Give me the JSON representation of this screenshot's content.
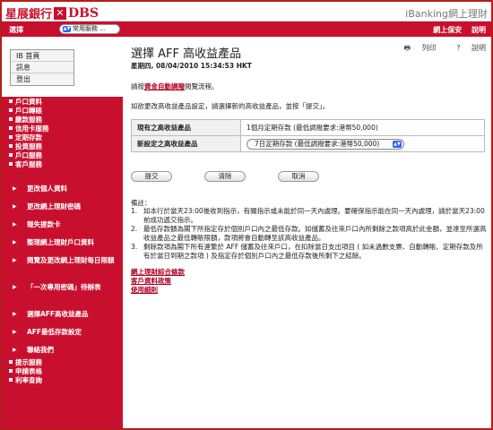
{
  "header": {
    "logo_cn": "星展銀行",
    "logo_dbs": "DBS",
    "title": "iBanking網上理財"
  },
  "navbar": {
    "select_label": "選擇",
    "select_value": "常用服務 ...",
    "right_links": [
      "網上保安",
      "說明"
    ]
  },
  "sidebar": {
    "top_links": [
      "IB 首頁",
      "訊息",
      "登出"
    ],
    "sections_top": [
      "戶口資料",
      "戶口轉賬",
      "繳款服務",
      "信用卡服務",
      "定期存款",
      "投資服務",
      "戶口服務",
      "客戶服務"
    ],
    "sub_items": [
      "更改個人資料",
      "更改網上理財密碼",
      "報失提款卡",
      "整理網上理財戶口資料",
      "閱覽及更改網上理財每日限額",
      "「一次專用密碼」待辦表",
      "選擇AFF高收益產品",
      "AFF最低存款設定",
      "聯絡我們"
    ],
    "sections_bottom": [
      "提示服務",
      "申請表格",
      "利率查詢"
    ]
  },
  "main": {
    "print_label": "列印",
    "help_label": "說明",
    "title": "選擇 AFF 高收益產品",
    "timestamp": "星期四, 08/04/2010 15:34:53 HKT",
    "line1_prefix": "請按",
    "line1_link": "資金自動調撥",
    "line1_suffix": "閱覽流程。",
    "line2": "如欲更改高收益產品設定，請選擇新的高收益產品，並按「提交」。",
    "current_label": "現有之高收益產品",
    "current_value": "1個月定期存款 (最低調撥要求:港幣50,000)",
    "new_label": "新設定之高收益產品",
    "new_value": "7日定期存款 (最低調撥要求:港幣50,000)",
    "buttons": [
      "提交",
      "清除",
      "取消"
    ],
    "remarks_title": "備註：",
    "remarks": [
      {
        "num": "1.",
        "text": "如本行於當天23:00後收到指示，有關指示或未能於同一天內處理。要確保指示能在同一天內處理，請於當天23:00前成功遞交指示。"
      },
      {
        "num": "2.",
        "text": "最低存款額為閣下所指定存於個別戶口內之最低存款。如儲蓄及往來戶口內所剩餘之款項高於此金額，並達至所選高收益產品之最低轉賬限額，款項將會自動轉至該高收益產品。"
      },
      {
        "num": "3.",
        "text": "剩餘款項為閣下所有連繫於 AFF 儲蓄及往來戶口，在扣除當日支出項目 ( 如未過數支票、自動轉賬、定期存款及所有於當日到期之款項 ) 及指定存於個別戶口內之最低存款後所剩下之結餘。"
      }
    ],
    "links": [
      "網上理財綜合條款",
      "客戶資料政策",
      "使用細則"
    ]
  }
}
